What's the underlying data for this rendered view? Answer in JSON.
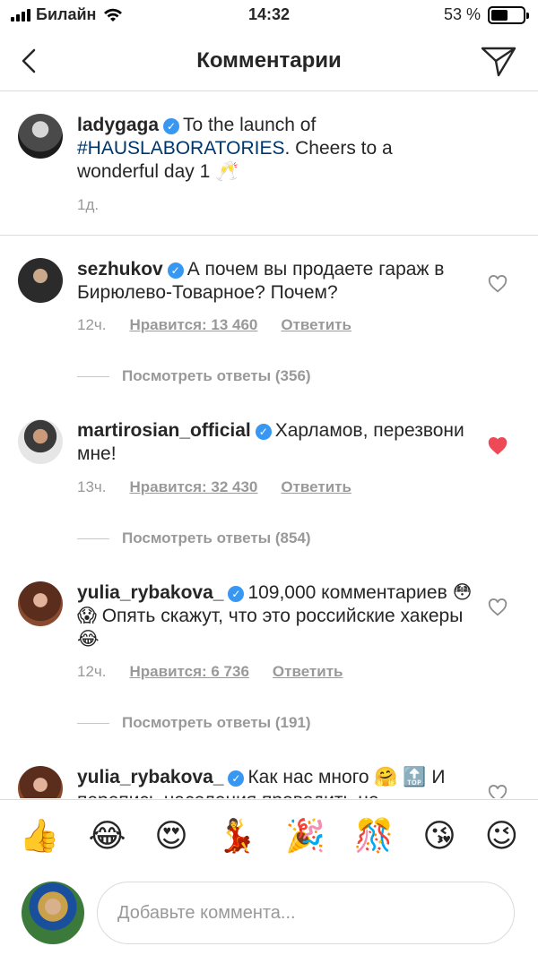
{
  "status": {
    "carrier": "Билайн",
    "time": "14:32",
    "battery": "53 %",
    "battery_level": 0.53
  },
  "header": {
    "title": "Комментарии"
  },
  "caption": {
    "username": "ladygaga",
    "text_pre": "To the launch of",
    "hashtag": "#HAUSLABORATORIES",
    "text_post": ". Cheers to a wonderful day 1 🥂",
    "time": "1д."
  },
  "comments": [
    {
      "username": "sezhukov",
      "text": "А почем вы продаете гараж в Бирюлево-Товарное? Почем?",
      "time": "12ч.",
      "likes": "Нравится: 13 460",
      "reply": "Ответить",
      "liked": false,
      "view_replies": "Посмотреть ответы (356)"
    },
    {
      "username": "martirosian_official",
      "text": "Харламов, перезвони мне!",
      "time": "13ч.",
      "likes": "Нравится: 32 430",
      "reply": "Ответить",
      "liked": true,
      "view_replies": "Посмотреть ответы (854)"
    },
    {
      "username": "yulia_rybakova_",
      "text": "109,000 комментариев 😳 😱 Опять скажут, что это российские хакеры 😂",
      "time": "12ч.",
      "likes": "Нравится: 6 736",
      "reply": "Ответить",
      "liked": false,
      "view_replies": "Посмотреть ответы (191)"
    },
    {
      "username": "yulia_rybakova_",
      "text": "Как нас много 🤗 🔝",
      "text_cut": "И перепись населения проводить не",
      "liked": false
    }
  ],
  "emoji_bar": [
    "👍",
    "😂",
    "😍",
    "💃",
    "🎉",
    "🎊",
    "😘",
    "😉"
  ],
  "composer": {
    "placeholder": "Добавьте коммента..."
  },
  "colors": {
    "verified": "#3897f0",
    "liked_heart": "#ed4956",
    "hashtag": "#003569",
    "muted": "#999999"
  }
}
